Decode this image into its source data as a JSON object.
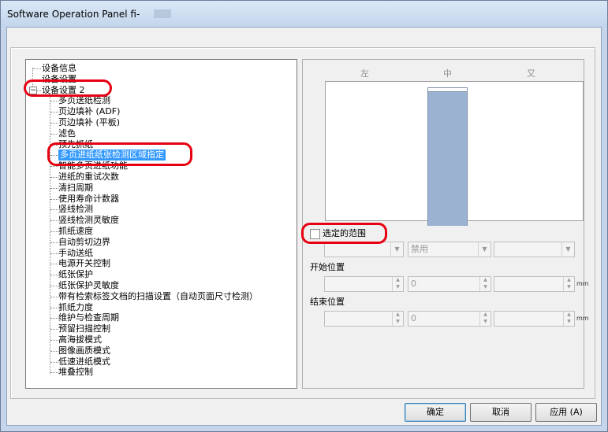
{
  "window": {
    "title": "Software Operation Panel fi-"
  },
  "tree": {
    "items": [
      {
        "label": "设备信息",
        "level": 0
      },
      {
        "label": "设备设置",
        "level": 0
      },
      {
        "label": "设备设置 2",
        "level": 0,
        "expander": "⊟"
      },
      {
        "label": "多页送纸检测",
        "level": 1
      },
      {
        "label": "页边填补 (ADF)",
        "level": 1
      },
      {
        "label": "页边填补 (平板)",
        "level": 1
      },
      {
        "label": "滤色",
        "level": 1
      },
      {
        "label": "预先抓纸",
        "level": 1
      },
      {
        "label": "多页进纸纸张检测区域指定",
        "level": 1,
        "selected": true
      },
      {
        "label": "智能多页进纸功能",
        "level": 1
      },
      {
        "label": "进纸的重试次数",
        "level": 1
      },
      {
        "label": "清扫周期",
        "level": 1
      },
      {
        "label": "使用寿命计数器",
        "level": 1
      },
      {
        "label": "竖线检测",
        "level": 1
      },
      {
        "label": "竖线检测灵敏度",
        "level": 1
      },
      {
        "label": "抓纸速度",
        "level": 1
      },
      {
        "label": "自动剪切边界",
        "level": 1
      },
      {
        "label": "手动送纸",
        "level": 1
      },
      {
        "label": "电源开关控制",
        "level": 1
      },
      {
        "label": "纸张保护",
        "level": 1
      },
      {
        "label": "纸张保护灵敏度",
        "level": 1
      },
      {
        "label": "带有检索标签文档的扫描设置（自动页面尺寸检测）",
        "level": 1
      },
      {
        "label": "抓纸力度",
        "level": 1
      },
      {
        "label": "维护与检查周期",
        "level": 1
      },
      {
        "label": "预留扫描控制",
        "level": 1
      },
      {
        "label": "高海拔模式",
        "level": 1
      },
      {
        "label": "图像画质模式",
        "level": 1
      },
      {
        "label": "低速进纸模式",
        "level": 1
      },
      {
        "label": "堆叠控制",
        "level": 1
      }
    ]
  },
  "preview": {
    "col_left": "左",
    "col_center": "中",
    "col_right": "又"
  },
  "range": {
    "checkbox_label": "选定的范围",
    "checked": false,
    "combo1_value": "",
    "combo2_value": "禁用",
    "combo3_value": ""
  },
  "start": {
    "label": "开始位置",
    "value1": "",
    "value2": "0",
    "value3": "",
    "unit": "mm"
  },
  "end": {
    "label": "结束位置",
    "value1": "",
    "value2": "0",
    "value3": "",
    "unit": "mm"
  },
  "buttons": {
    "ok": "确定",
    "cancel": "取消",
    "apply": "应用 (A)"
  },
  "colors": {
    "highlight": "#e60012",
    "selection": "#3399ff",
    "paper": "#9bb2d1"
  }
}
